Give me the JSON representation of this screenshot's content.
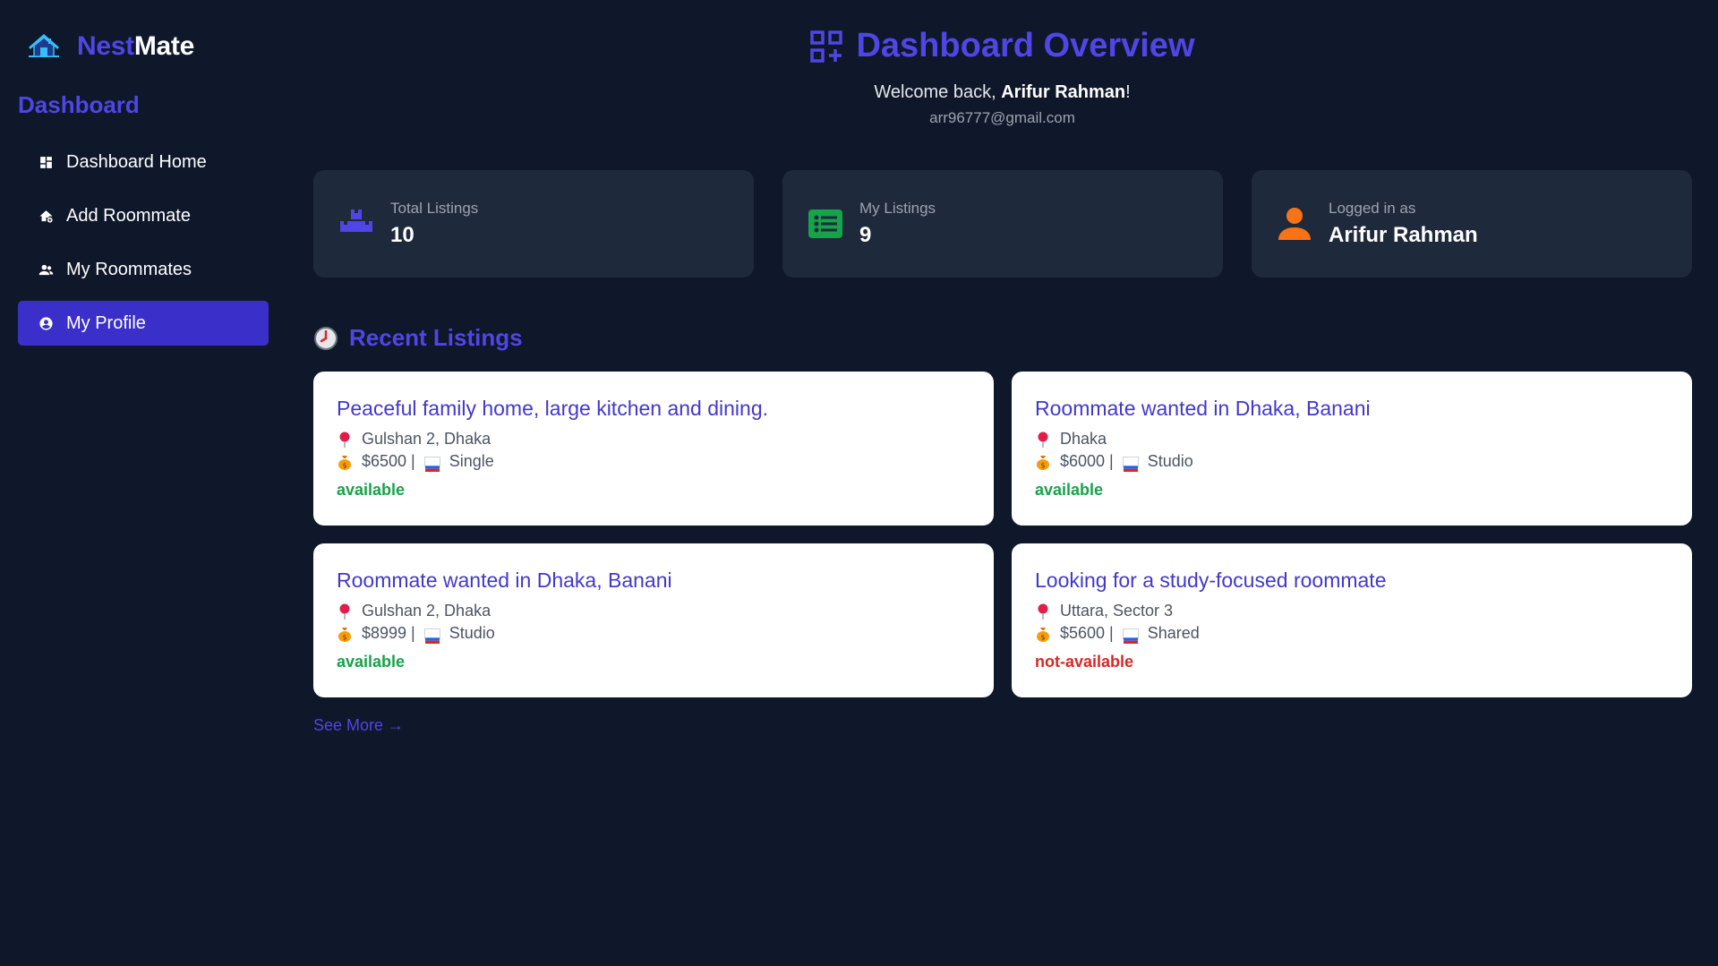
{
  "brand": {
    "part1": "Nest",
    "part2": "Mate",
    "icon": "house-icon"
  },
  "sidebar": {
    "heading": "Dashboard",
    "items": [
      {
        "label": "Dashboard Home",
        "icon": "grid-icon"
      },
      {
        "label": "Add Roommate",
        "icon": "add-home-icon"
      },
      {
        "label": "My Roommates",
        "icon": "people-icon"
      },
      {
        "label": "My Profile",
        "icon": "user-circle-icon",
        "active": true
      }
    ]
  },
  "header": {
    "title": "Dashboard Overview",
    "welcome_prefix": "Welcome back, ",
    "user_name": "Arifur Rahman",
    "welcome_suffix": "!",
    "email": "arr96777@gmail.com"
  },
  "stats": [
    {
      "label": "Total Listings",
      "value": "10",
      "icon": "boxes-icon",
      "color": "#4f46e5"
    },
    {
      "label": "My Listings",
      "value": "9",
      "icon": "list-icon",
      "color": "#16a34a"
    },
    {
      "label": "Logged in as",
      "value": "Arifur Rahman",
      "icon": "user-icon",
      "color": "#f97316"
    }
  ],
  "recent": {
    "title": "Recent Listings",
    "icon": "clock-icon",
    "listings": [
      {
        "title": "Peaceful family home, large kitchen and dining.",
        "location": "Gulshan 2, Dhaka",
        "price": "$6500 |",
        "type": "Single",
        "status": "available"
      },
      {
        "title": "Roommate wanted in Dhaka, Banani",
        "location": "Dhaka",
        "price": "$6000 |",
        "type": "Studio",
        "status": "available"
      },
      {
        "title": "Roommate wanted in Dhaka, Banani",
        "location": "Gulshan 2, Dhaka",
        "price": "$8999 |",
        "type": "Studio",
        "status": "available"
      },
      {
        "title": "Looking for a study-focused roommate",
        "location": "Uttara, Sector 3",
        "price": "$5600 |",
        "type": "Shared",
        "status": "not-available"
      }
    ],
    "see_more": "See More →"
  },
  "colors": {
    "accent": "#4f46e5",
    "background": "#0f172a",
    "card": "#1e293b",
    "available": "#16a34a",
    "unavailable": "#dc2626"
  }
}
